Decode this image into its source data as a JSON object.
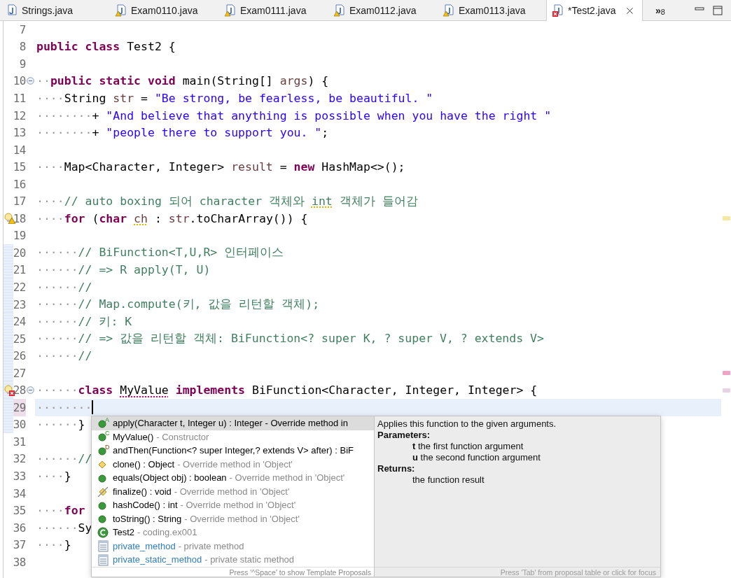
{
  "tabs": [
    {
      "label": "Strings.java",
      "kind": "plain",
      "selected": false
    },
    {
      "label": "Exam0110.java",
      "kind": "warning",
      "selected": false
    },
    {
      "label": "Exam0111.java",
      "kind": "warning",
      "selected": false
    },
    {
      "label": "Exam0112.java",
      "kind": "warning",
      "selected": false
    },
    {
      "label": "Exam0113.java",
      "kind": "warning",
      "selected": false
    },
    {
      "label": "*Test2.java",
      "kind": "error",
      "selected": true
    }
  ],
  "overflow": {
    "symbol": "»",
    "count": "8"
  },
  "editor": {
    "lines": [
      {
        "number": "7",
        "kind": "plain",
        "current": false,
        "changed": false
      },
      {
        "number": "8",
        "kind": "plain",
        "current": false,
        "changed": false,
        "tokens": [
          {
            "kind": "kw",
            "text": "public "
          },
          {
            "kind": "kw",
            "text": "class "
          },
          {
            "kind": "plain",
            "text": "Test2 {"
          }
        ]
      },
      {
        "number": "9",
        "kind": "plain",
        "current": false,
        "changed": false
      },
      {
        "number": "10",
        "kind": "plain",
        "current": false,
        "changed": false,
        "fold": true,
        "tokens": [
          {
            "kind": "ws",
            "text": "··"
          },
          {
            "kind": "kw",
            "text": "public "
          },
          {
            "kind": "kw",
            "text": "static "
          },
          {
            "kind": "kw",
            "text": "void "
          },
          {
            "kind": "plain",
            "text": "main(String[] "
          },
          {
            "kind": "var",
            "text": "args"
          },
          {
            "kind": "plain",
            "text": ") {"
          }
        ]
      },
      {
        "number": "11",
        "kind": "plain",
        "current": false,
        "changed": false,
        "tokens": [
          {
            "kind": "ws",
            "text": "····"
          },
          {
            "kind": "plain",
            "text": "String "
          },
          {
            "kind": "var",
            "text": "str"
          },
          {
            "kind": "plain",
            "text": " = "
          },
          {
            "kind": "string",
            "text": "\"Be strong, be fearless, be beautiful. \""
          }
        ]
      },
      {
        "number": "12",
        "kind": "plain",
        "current": false,
        "changed": false,
        "tokens": [
          {
            "kind": "ws",
            "text": "········"
          },
          {
            "kind": "plain",
            "text": "+ "
          },
          {
            "kind": "string",
            "text": "\"And believe that anything is possible when you have the right \""
          }
        ]
      },
      {
        "number": "13",
        "kind": "plain",
        "current": false,
        "changed": false,
        "tokens": [
          {
            "kind": "ws",
            "text": "········"
          },
          {
            "kind": "plain",
            "text": "+ "
          },
          {
            "kind": "string",
            "text": "\"people there to support you. \""
          },
          {
            "kind": "plain",
            "text": ";"
          }
        ]
      },
      {
        "number": "14",
        "kind": "plain",
        "current": false,
        "changed": false
      },
      {
        "number": "15",
        "kind": "plain",
        "current": false,
        "changed": false,
        "tokens": [
          {
            "kind": "ws",
            "text": "····"
          },
          {
            "kind": "plain",
            "text": "Map<Character, Integer> "
          },
          {
            "kind": "var",
            "text": "result"
          },
          {
            "kind": "plain",
            "text": " = "
          },
          {
            "kind": "kw",
            "text": "new"
          },
          {
            "kind": "plain",
            "text": " HashMap<>();"
          }
        ]
      },
      {
        "number": "16",
        "kind": "plain",
        "current": false,
        "changed": false
      },
      {
        "number": "17",
        "kind": "plain",
        "current": false,
        "changed": false,
        "tokens": [
          {
            "kind": "ws",
            "text": "····"
          },
          {
            "kind": "comment",
            "text": "// auto boxing 되어 character 객체와 "
          },
          {
            "kind": "warncomment",
            "text": "int"
          },
          {
            "kind": "comment",
            "text": " 객체가 들어감"
          }
        ]
      },
      {
        "number": "18",
        "kind": "warning",
        "current": false,
        "changed": false,
        "ruler_marker": {
          "color": "#f5e6a0"
        },
        "tokens": [
          {
            "kind": "ws",
            "text": "····"
          },
          {
            "kind": "kw",
            "text": "for"
          },
          {
            "kind": "plain",
            "text": " ("
          },
          {
            "kind": "kw",
            "text": "char "
          },
          {
            "kind": "warnvar",
            "text": "ch"
          },
          {
            "kind": "plain",
            "text": " : "
          },
          {
            "kind": "var",
            "text": "str"
          },
          {
            "kind": "plain",
            "text": ".toCharArray()) {"
          }
        ]
      },
      {
        "number": "19",
        "kind": "plain",
        "current": false,
        "changed": false
      },
      {
        "number": "20",
        "kind": "plain",
        "current": false,
        "changed": true,
        "tokens": [
          {
            "kind": "ws",
            "text": "······"
          },
          {
            "kind": "comment",
            "text": "// BiFunction<T,U,R> 인터페이스"
          }
        ]
      },
      {
        "number": "21",
        "kind": "plain",
        "current": false,
        "changed": true,
        "tokens": [
          {
            "kind": "ws",
            "text": "······"
          },
          {
            "kind": "comment",
            "text": "// => R apply(T, U)"
          }
        ]
      },
      {
        "number": "22",
        "kind": "plain",
        "current": false,
        "changed": true,
        "tokens": [
          {
            "kind": "ws",
            "text": "······"
          },
          {
            "kind": "comment",
            "text": "//"
          }
        ]
      },
      {
        "number": "23",
        "kind": "plain",
        "current": false,
        "changed": true,
        "tokens": [
          {
            "kind": "ws",
            "text": "······"
          },
          {
            "kind": "comment",
            "text": "// Map.compute(키, 값을 리턴할 객체);"
          }
        ]
      },
      {
        "number": "24",
        "kind": "plain",
        "current": false,
        "changed": true,
        "tokens": [
          {
            "kind": "ws",
            "text": "······"
          },
          {
            "kind": "comment",
            "text": "// 키: K"
          }
        ]
      },
      {
        "number": "25",
        "kind": "plain",
        "current": false,
        "changed": true,
        "tokens": [
          {
            "kind": "ws",
            "text": "······"
          },
          {
            "kind": "comment",
            "text": "// => 값을 리턴할 객체: BiFunction<? super K, ? super V, ? extends V>"
          }
        ]
      },
      {
        "number": "26",
        "kind": "plain",
        "current": false,
        "changed": true,
        "tokens": [
          {
            "kind": "ws",
            "text": "······"
          },
          {
            "kind": "comment",
            "text": "//"
          }
        ]
      },
      {
        "number": "27",
        "kind": "plain",
        "current": false,
        "changed": true,
        "ruler_marker": {
          "color": "#f0a3c4"
        }
      },
      {
        "number": "28",
        "kind": "error",
        "current": false,
        "changed": true,
        "fold": true,
        "ruler_marker": {
          "color": "#e8d3e6"
        },
        "tokens": [
          {
            "kind": "ws",
            "text": "······"
          },
          {
            "kind": "kw",
            "text": "class "
          },
          {
            "kind": "errorname",
            "text": "MyValue"
          },
          {
            "kind": "kw",
            "text": " implements"
          },
          {
            "kind": "plain",
            "text": " BiFunction<Character, Integer, Integer> {"
          }
        ]
      },
      {
        "number": "29",
        "kind": "plain",
        "current": true,
        "changed": true,
        "tokens": [
          {
            "kind": "ws",
            "text": "········"
          }
        ]
      },
      {
        "number": "30",
        "kind": "plain",
        "current": false,
        "changed": true,
        "tokens": [
          {
            "kind": "ws",
            "text": "······"
          },
          {
            "kind": "plain",
            "text": "}"
          }
        ]
      },
      {
        "number": "31",
        "kind": "plain",
        "current": false,
        "changed": false
      },
      {
        "number": "32",
        "kind": "plain",
        "current": false,
        "changed": false,
        "tokens": [
          {
            "kind": "ws",
            "text": "······"
          },
          {
            "kind": "comment",
            "text": "//"
          }
        ]
      },
      {
        "number": "33",
        "kind": "plain",
        "current": false,
        "changed": false,
        "tokens": [
          {
            "kind": "ws",
            "text": "····"
          },
          {
            "kind": "plain",
            "text": "}"
          }
        ]
      },
      {
        "number": "34",
        "kind": "plain",
        "current": false,
        "changed": false
      },
      {
        "number": "35",
        "kind": "plain",
        "current": false,
        "changed": false,
        "tokens": [
          {
            "kind": "ws",
            "text": "····"
          },
          {
            "kind": "kw",
            "text": "for"
          }
        ]
      },
      {
        "number": "36",
        "kind": "plain",
        "current": false,
        "changed": false,
        "tokens": [
          {
            "kind": "ws",
            "text": "······"
          },
          {
            "kind": "plain",
            "text": "Sy"
          }
        ]
      },
      {
        "number": "37",
        "kind": "plain",
        "current": false,
        "changed": false,
        "tokens": [
          {
            "kind": "ws",
            "text": "····"
          },
          {
            "kind": "plain",
            "text": "}"
          }
        ]
      },
      {
        "number": "38",
        "kind": "plain",
        "current": false,
        "changed": false
      }
    ]
  },
  "content_assist": {
    "proposals": [
      {
        "kind": "method",
        "badge": "A",
        "text": "apply(Character t, Integer u) : Integer - Override method in",
        "selected": true
      },
      {
        "kind": "method",
        "badge": "C",
        "text": "MyValue()",
        "detail": "- Constructor",
        "selected": false
      },
      {
        "kind": "defaultmethod",
        "badge": "D",
        "text": "andThen(Function<? super Integer,? extends V> after) : BiF",
        "selected": false
      },
      {
        "kind": "protected",
        "text": "clone() : Object",
        "detail": "- Override method in 'Object'",
        "selected": false
      },
      {
        "kind": "method",
        "text": "equals(Object obj) : boolean",
        "detail": "- Override method in 'Object'",
        "selected": false
      },
      {
        "kind": "deprecated",
        "text": "finalize() : void",
        "detail": "- Override method in 'Object'",
        "selected": false
      },
      {
        "kind": "method",
        "text": "hashCode() : int",
        "detail": "- Override method in 'Object'",
        "selected": false
      },
      {
        "kind": "method",
        "text": "toString() : String",
        "detail": "- Override method in 'Object'",
        "selected": false
      },
      {
        "kind": "class",
        "text": "Test2",
        "detail": "- coding.ex001",
        "selected": false
      },
      {
        "kind": "template",
        "text": "private_method",
        "detail": "- private method",
        "selected": false
      },
      {
        "kind": "template",
        "text": "private_static_method",
        "detail": "- private static method",
        "selected": false
      }
    ],
    "proposals_footer": "Press '^Space' to show Template Proposals",
    "doc": {
      "summary": "Applies this function to the given arguments.",
      "sections": [
        {
          "heading": "Parameters:",
          "lines": [
            "**t** the first function argument",
            "**u** the second function argument"
          ]
        },
        {
          "heading": "Returns:",
          "lines": [
            "the function result"
          ]
        }
      ],
      "footer": "Press 'Tab' from proposal table or click for focus"
    }
  }
}
